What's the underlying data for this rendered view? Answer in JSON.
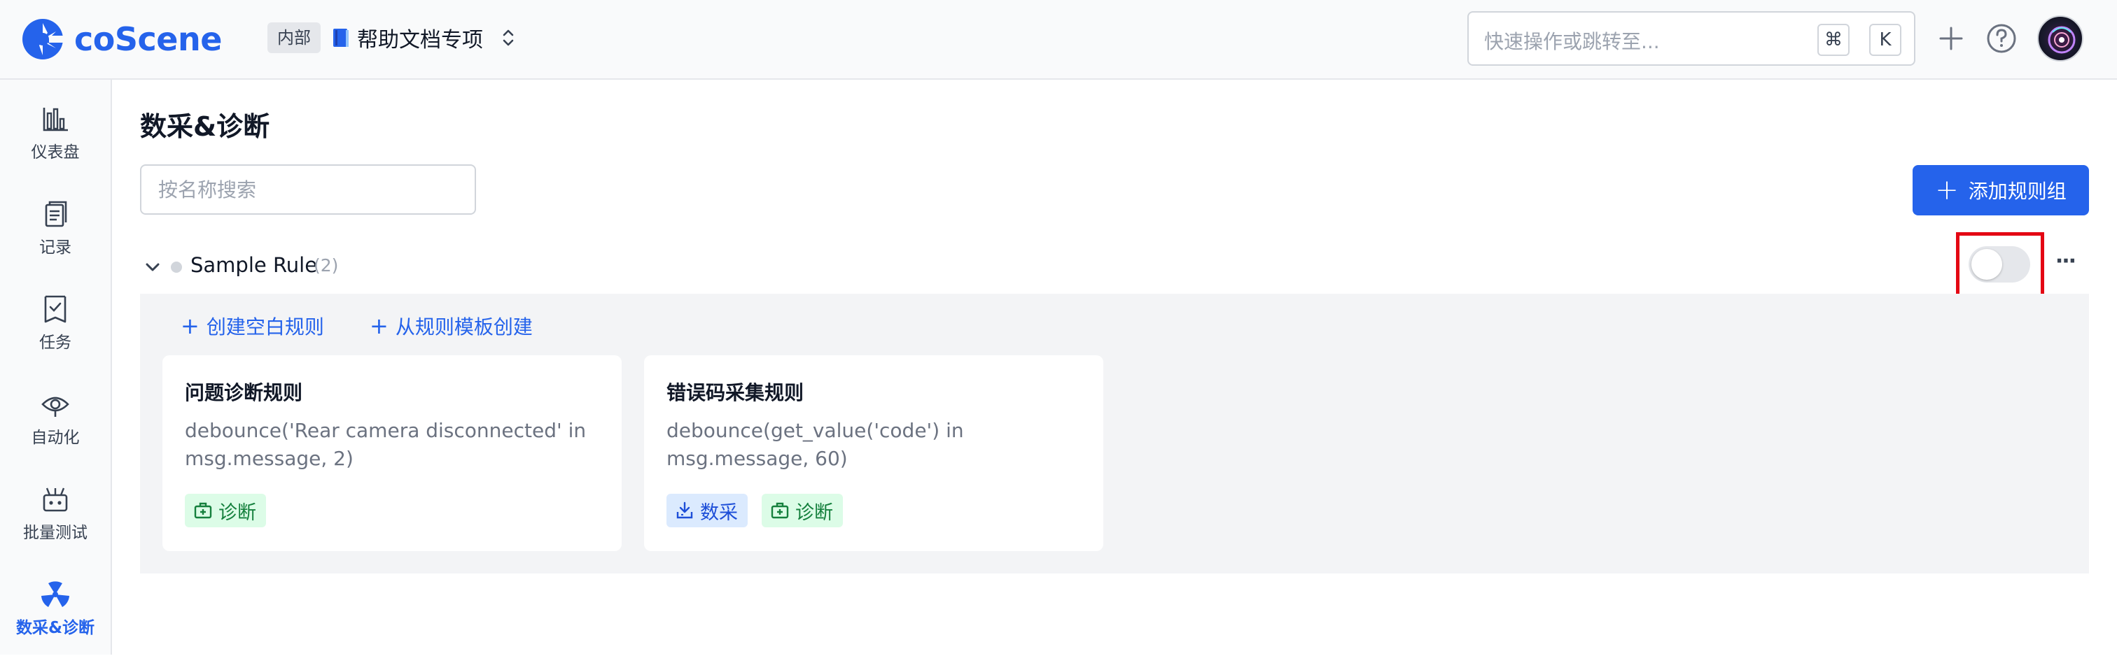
{
  "header": {
    "brand": "coScene",
    "workspace_badge": "内部",
    "project_name": "帮助文档专项",
    "search_placeholder": "快速操作或跳转至...",
    "shortcut_cmd": "⌘",
    "shortcut_key": "K",
    "icons": [
      "plus-icon",
      "help-icon",
      "avatar"
    ]
  },
  "sidebar": {
    "items": [
      {
        "label": "仪表盘",
        "icon": "dashboard-icon",
        "active": false
      },
      {
        "label": "记录",
        "icon": "record-icon",
        "active": false
      },
      {
        "label": "任务",
        "icon": "task-icon",
        "active": false
      },
      {
        "label": "自动化",
        "icon": "automation-icon",
        "active": false
      },
      {
        "label": "批量测试",
        "icon": "batch-test-icon",
        "active": false
      },
      {
        "label": "数采&诊断",
        "icon": "diagnosis-icon",
        "active": true
      }
    ]
  },
  "main": {
    "title": "数采&诊断",
    "search_placeholder": "按名称搜索",
    "add_group_label": "添加规则组",
    "rule_group": {
      "name": "Sample Rule",
      "count": "(2)",
      "enabled": false,
      "create_blank_label": "创建空白规则",
      "create_from_template_label": "从规则模板创建",
      "rules": [
        {
          "title": "问题诊断规则",
          "expression": "debounce('Rear camera disconnected' in msg.message, 2)",
          "tags": [
            {
              "label": "诊断",
              "type": "diag"
            }
          ]
        },
        {
          "title": "错误码采集规则",
          "expression": "debounce(get_value('code') in msg.message, 60)",
          "tags": [
            {
              "label": "数采",
              "type": "collect"
            },
            {
              "label": "诊断",
              "type": "diag"
            }
          ]
        }
      ]
    }
  },
  "colors": {
    "accent": "#2563eb",
    "highlight_box": "#e40613",
    "diag_tag_bg": "#dcfce7",
    "collect_tag_bg": "#dbeafe"
  }
}
